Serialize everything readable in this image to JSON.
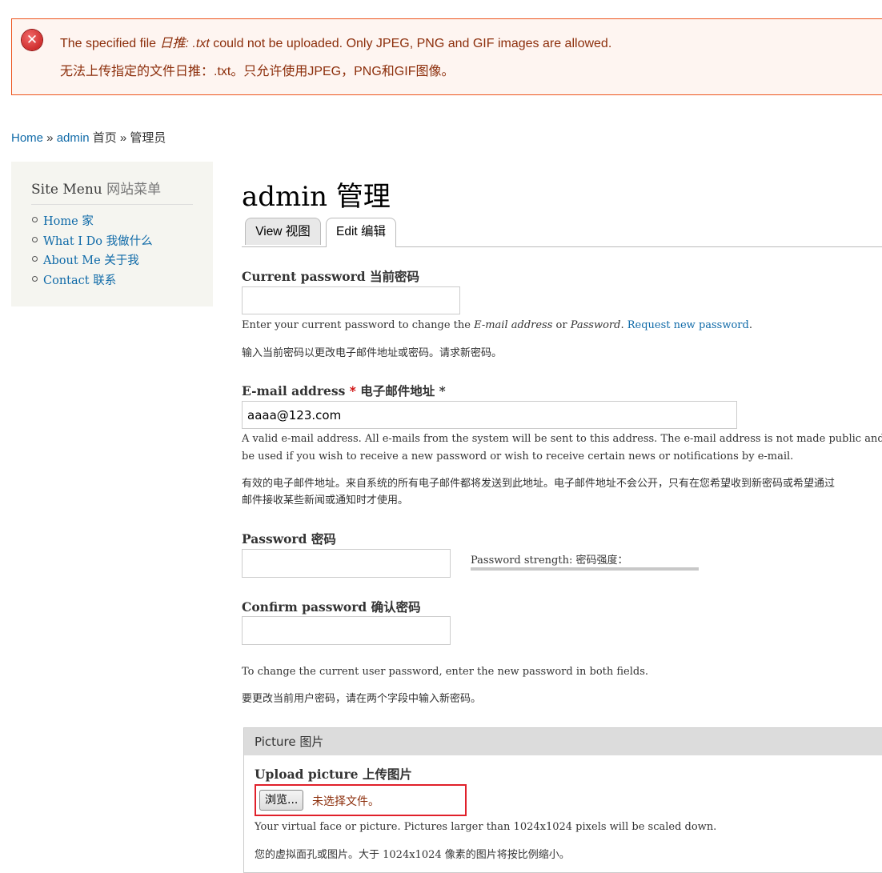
{
  "error": {
    "line1_prefix": "The specified file ",
    "line1_file": "日推:",
    "line1_ext": ".txt",
    "line1_suffix": " could not be uploaded. Only JPEG, PNG and GIF images are allowed.",
    "line2": "无法上传指定的文件日推：.txt。只允许使用JPEG，PNG和GIF图像。",
    "icon": "error-x-icon"
  },
  "breadcrumb": {
    "home": "Home",
    "sep": " » ",
    "admin": "admin",
    "home_cn": " 首页",
    "sep2": " » ",
    "current": "管理员"
  },
  "sidebar": {
    "title": "Site Menu",
    "title_cn": " 网站菜单",
    "items": [
      {
        "label": "Home 家"
      },
      {
        "label": "What I Do 我做什么"
      },
      {
        "label": "About Me 关于我"
      },
      {
        "label": "Contact 联系"
      }
    ]
  },
  "page": {
    "title": "admin  管理",
    "tabs": [
      {
        "label": "View 视图"
      },
      {
        "label": "Edit 编辑"
      }
    ]
  },
  "form": {
    "current_password": {
      "label": "Current password  当前密码",
      "value": "",
      "desc_1": "Enter your current password to change the ",
      "desc_email": "E-mail address",
      "desc_or": " or ",
      "desc_password": "Password",
      "desc_dot": ". ",
      "desc_link": "Request new password",
      "desc_end": ".",
      "desc_cn": "输入当前密码以更改电子邮件地址或密码。请求新密码。"
    },
    "email": {
      "label": "E-mail address",
      "required": " *",
      "label_cn": " 电子邮件地址 *",
      "value": "aaaa@123.com",
      "desc_en1": "A valid e-mail address. All e-mails from the system will be sent to this address. The e-mail address is not made public and will o",
      "desc_en2": "be used if you wish to receive a new password or wish to receive certain news or notifications by e-mail.",
      "desc_cn1": "有效的电子邮件地址。来自系统的所有电子邮件都将发送到此地址。电子邮件地址不会公开，只有在您希望收到新密码或希望通过",
      "desc_cn2": "邮件接收某些新闻或通知时才使用。"
    },
    "password": {
      "label": "Password  密码",
      "value": "",
      "strength": "Password strength: 密码强度："
    },
    "confirm_password": {
      "label": "Confirm password  确认密码",
      "value": ""
    },
    "password_hint_en": "To change the current user password, enter the new password in both fields.",
    "password_hint_cn": "要更改当前用户密码，请在两个字段中输入新密码。",
    "picture": {
      "legend": "Picture 图片",
      "upload_label": "Upload picture  上传图片",
      "browse": "浏览...",
      "no_file": "未选择文件。",
      "desc_en": "Your virtual face or picture. Pictures larger than 1024x1024 pixels will be scaled down.",
      "desc_cn": "您的虚拟面孔或图片。大于 1024x1024 像素的图片将按比例缩小。"
    }
  },
  "colors": {
    "error_border": "#ed541d",
    "error_bg": "#fef5f1",
    "error_text": "#8c2e0b",
    "link": "#0f6aa8",
    "upload_highlight": "#e0202a"
  }
}
